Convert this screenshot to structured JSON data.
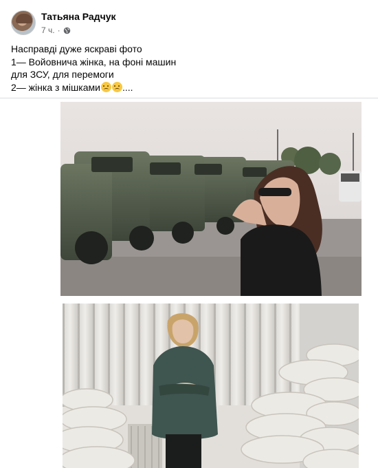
{
  "post": {
    "author": "Татьяна Радчук",
    "time": "7 ч.",
    "separator": "·",
    "privacy_icon": "globe-icon",
    "text_lines": [
      "Насправді дуже яскраві фото",
      "1— Войовнича жінка, на фоні машин",
      "для ЗСУ, для перемоги",
      "2— жінка з мішками"
    ],
    "line4_suffix": "...."
  },
  "photos": [
    {
      "subject": "woman in sunglasses in front of armored military vehicles"
    },
    {
      "subject": "woman in green blazer beside stacked sandbags and curtains"
    }
  ],
  "colors": {
    "author_text": "#050505",
    "meta_text": "#65676b",
    "divider": "#dadde1"
  }
}
